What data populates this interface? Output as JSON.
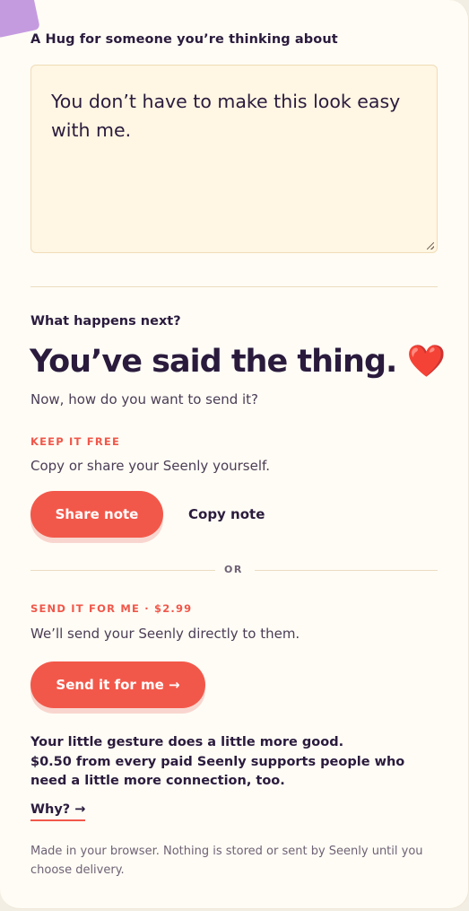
{
  "note": {
    "label": "A Hug for someone you’re thinking about",
    "text": "You don’t have to make this look easy with me."
  },
  "next": {
    "label": "What happens next?",
    "headline": "You’ve said the thing.",
    "heart": "❤️",
    "subhead": "Now, how do you want to send it?"
  },
  "free": {
    "tag": "KEEP IT FREE",
    "desc": "Copy or share your Seenly yourself.",
    "share_label": "Share note",
    "copy_label": "Copy note"
  },
  "divider": {
    "or_text": "OR"
  },
  "paid": {
    "tag": "SEND IT FOR ME · $2.99",
    "desc": "We’ll send your Seenly directly to them.",
    "send_label": "Send it for me →"
  },
  "impact": {
    "line1": "Your little gesture does a little more good.",
    "line2": "$0.50 from every paid Seenly supports people who need a little more connection, too.",
    "why_label": "Why? →"
  },
  "footnote": "Made in your browser. Nothing is stored or sent by Seenly until you choose delivery.",
  "colors": {
    "accent": "#f2584a",
    "ink": "#2a1b3d",
    "note_bg": "#fff6e3",
    "deco": "#c59be0"
  }
}
